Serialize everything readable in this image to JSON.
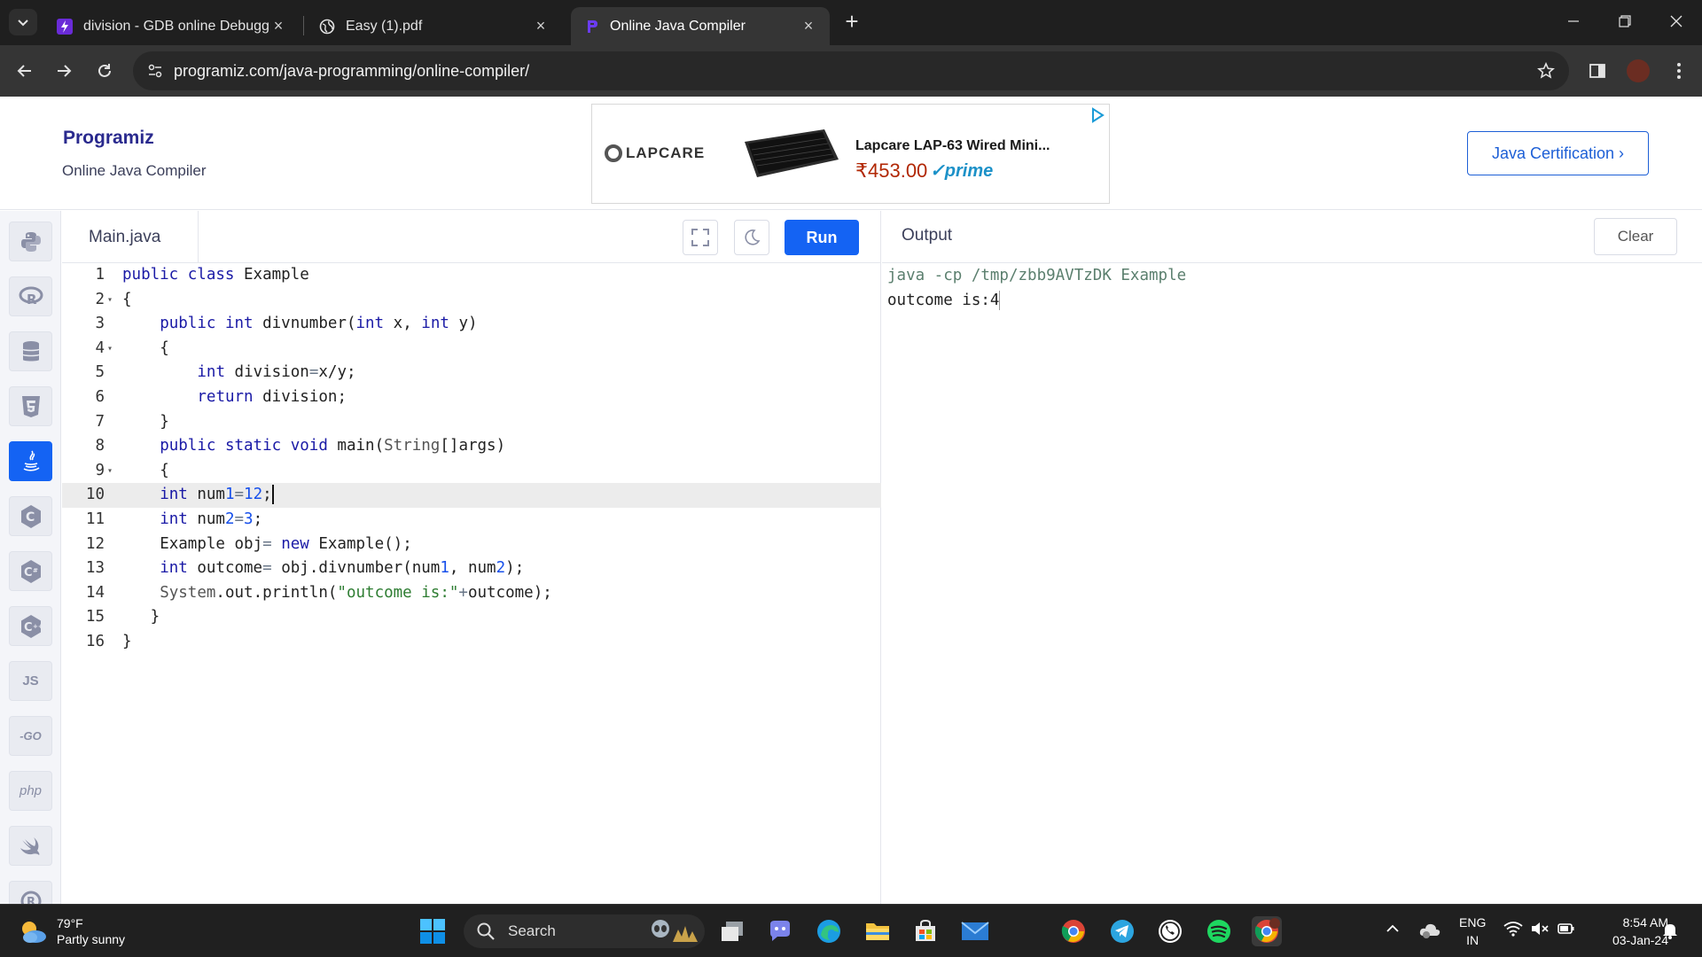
{
  "browser": {
    "tabs": [
      {
        "label": "division - GDB online Debugger",
        "active": false
      },
      {
        "label": "Easy (1).pdf",
        "active": false
      },
      {
        "label": "Online Java Compiler",
        "active": true
      }
    ],
    "url": "programiz.com/java-programming/online-compiler/"
  },
  "header": {
    "logo": "Programiz",
    "subtitle": "Online Java Compiler",
    "cert_button": "Java Certification ›",
    "ad": {
      "brand": "LAPCARE",
      "title": "Lapcare LAP-63 Wired Mini...",
      "price": "₹453.00",
      "badge": "prime"
    }
  },
  "sidebar": {
    "languages": [
      {
        "name": "python",
        "glyph": "Py"
      },
      {
        "name": "r",
        "glyph": "R"
      },
      {
        "name": "sql",
        "glyph": "DB"
      },
      {
        "name": "html",
        "glyph": "5"
      },
      {
        "name": "java",
        "glyph": "J",
        "active": true
      },
      {
        "name": "c",
        "glyph": "C"
      },
      {
        "name": "csharp",
        "glyph": "C#"
      },
      {
        "name": "cpp",
        "glyph": "C+"
      },
      {
        "name": "javascript",
        "glyph": "JS"
      },
      {
        "name": "go",
        "glyph": "-GO"
      },
      {
        "name": "php",
        "glyph": "php"
      },
      {
        "name": "swift",
        "glyph": "S"
      },
      {
        "name": "rust",
        "glyph": "R"
      }
    ]
  },
  "editor": {
    "filename": "Main.java",
    "run_label": "Run",
    "active_line": 10,
    "lines": [
      {
        "n": "1",
        "fold": "",
        "text": "public class Example"
      },
      {
        "n": "2",
        "fold": "▾",
        "text": "{"
      },
      {
        "n": "3",
        "fold": "",
        "text": "    public int divnumber(int x, int y)"
      },
      {
        "n": "4",
        "fold": "▾",
        "text": "    {"
      },
      {
        "n": "5",
        "fold": "",
        "text": "        int division=x/y;"
      },
      {
        "n": "6",
        "fold": "",
        "text": "        return division;"
      },
      {
        "n": "7",
        "fold": "",
        "text": "    }"
      },
      {
        "n": "8",
        "fold": "",
        "text": "    public static void main(String[]args)"
      },
      {
        "n": "9",
        "fold": "▾",
        "text": "    {"
      },
      {
        "n": "10",
        "fold": "",
        "text": "    int num1=12;"
      },
      {
        "n": "11",
        "fold": "",
        "text": "    int num2=3;"
      },
      {
        "n": "12",
        "fold": "",
        "text": "    Example obj= new Example();"
      },
      {
        "n": "13",
        "fold": "",
        "text": "    int outcome= obj.divnumber(num1, num2);"
      },
      {
        "n": "14",
        "fold": "",
        "text": "    System.out.println(\"outcome is:\"+outcome);"
      },
      {
        "n": "15",
        "fold": "",
        "text": "   }"
      },
      {
        "n": "16",
        "fold": "",
        "text": "}"
      }
    ]
  },
  "output": {
    "title": "Output",
    "clear_label": "Clear",
    "command": "java -cp /tmp/zbb9AVTzDK Example",
    "result": "outcome is:4"
  },
  "taskbar": {
    "weather_temp": "79°F",
    "weather_desc": "Partly sunny",
    "search_label": "Search",
    "lang_line1": "ENG",
    "lang_line2": "IN",
    "time": "8:54 AM",
    "date": "03-Jan-24"
  },
  "colors": {
    "accent": "#1463f3",
    "keyword": "#1a1aa6",
    "string": "#2e7d32",
    "output_command": "#5b7f6e"
  }
}
